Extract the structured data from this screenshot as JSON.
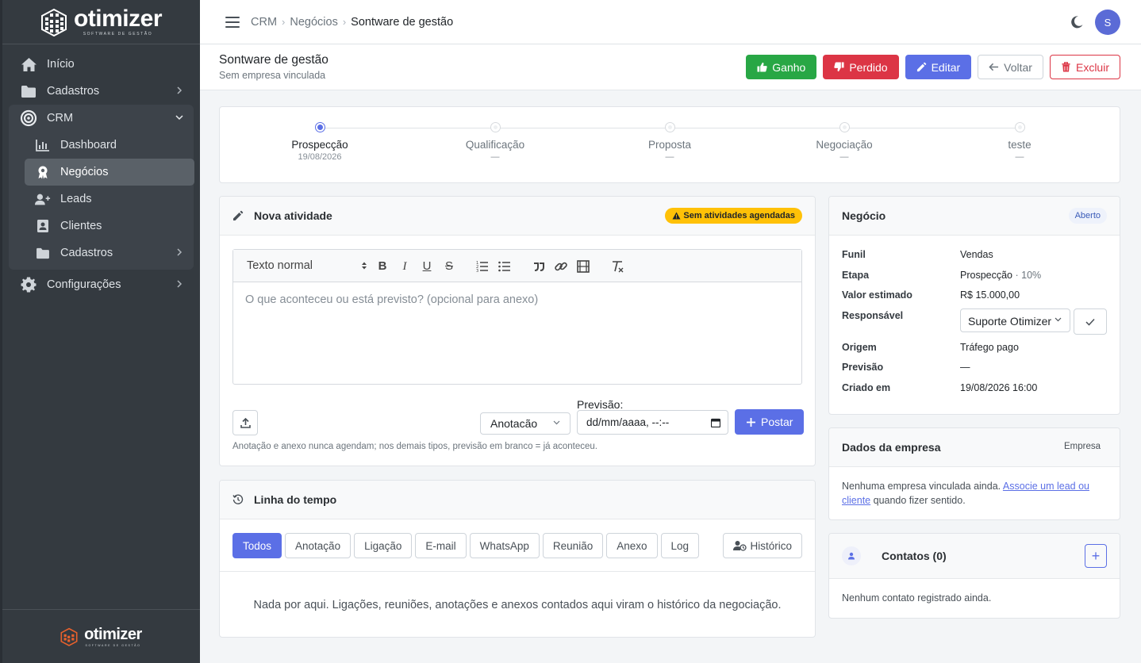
{
  "brand": {
    "name": "otimizer",
    "tagline": "SOFTWARE DE GESTÃO"
  },
  "sidebar": {
    "items": [
      {
        "label": "Início",
        "icon": "home-icon"
      },
      {
        "label": "Cadastros",
        "icon": "folder-icon"
      },
      {
        "label": "CRM",
        "icon": "target-icon"
      },
      {
        "label": "Configurações",
        "icon": "gear-icon"
      }
    ],
    "crm_sub": [
      {
        "label": "Dashboard",
        "icon": "chart-icon"
      },
      {
        "label": "Negócios",
        "icon": "award-icon",
        "active": true
      },
      {
        "label": "Leads",
        "icon": "user-plus-icon"
      },
      {
        "label": "Clientes",
        "icon": "contact-card-icon"
      },
      {
        "label": "Cadastros",
        "icon": "folder-icon"
      }
    ]
  },
  "topbar": {
    "breadcrumb": [
      "CRM",
      "Negócios",
      "Sontware de gestão"
    ],
    "avatar_initial": "S"
  },
  "page": {
    "title": "Sontware de gestão",
    "subtitle": "Sem empresa vinculada",
    "actions": {
      "won": "Ganho",
      "lost": "Perdido",
      "edit": "Editar",
      "back": "Voltar",
      "delete": "Excluir"
    }
  },
  "stages": [
    {
      "label": "Prospecção",
      "date": "19/08/2026",
      "active": true
    },
    {
      "label": "Qualificação",
      "date": "—"
    },
    {
      "label": "Proposta",
      "date": "—"
    },
    {
      "label": "Negociação",
      "date": "—"
    },
    {
      "label": "teste",
      "date": "—"
    }
  ],
  "activity": {
    "title": "Nova atividade",
    "badge": "Sem atividades agendadas",
    "text_style": "Texto normal",
    "placeholder": "O que aconteceu ou está previsto? (opcional para anexo)",
    "type": "Anotacão",
    "forecast_label": "Previsão:",
    "forecast_placeholder": "dd/mm/aaaa, --:--",
    "post": "Postar",
    "hint": "Anotação e anexo nunca agendam; nos demais tipos, previsão em branco = já aconteceu."
  },
  "timeline": {
    "title": "Linha do tempo",
    "filters": [
      "Todos",
      "Anotação",
      "Ligação",
      "E-mail",
      "WhatsApp",
      "Reunião",
      "Anexo",
      "Log"
    ],
    "history": "Histórico",
    "empty": "Nada por aqui. Ligações, reuniões, anotações e anexos contados aqui viram o histórico da negociação."
  },
  "deal": {
    "title": "Negócio",
    "status": "Aberto",
    "rows": {
      "funnel_k": "Funil",
      "funnel_v": "Vendas",
      "stage_k": "Etapa",
      "stage_v": "Prospecção",
      "stage_pct": " · 10%",
      "value_k": "Valor estimado",
      "value_v": "R$ 15.000,00",
      "owner_k": "Responsável",
      "owner_v": "Suporte Otimizer",
      "origin_k": "Origem",
      "origin_v": "Tráfego pago",
      "forecast_k": "Previsão",
      "forecast_v": "—",
      "created_k": "Criado em",
      "created_v": "19/08/2026 16:00"
    }
  },
  "company": {
    "title": "Dados da empresa",
    "tag": "Empresa",
    "text_a": "Nenhuma empresa vinculada ainda. ",
    "link": "Associe um lead ou cliente",
    "text_b": " quando fizer sentido."
  },
  "contacts": {
    "title": "Contatos (0)",
    "empty": "Nenhum contato registrado ainda.",
    "add": "+"
  },
  "colors": {
    "primary": "#5b6fe6",
    "success": "#28a745",
    "danger": "#dc3545",
    "warning": "#ffc107",
    "sidebar": "#343a40"
  }
}
